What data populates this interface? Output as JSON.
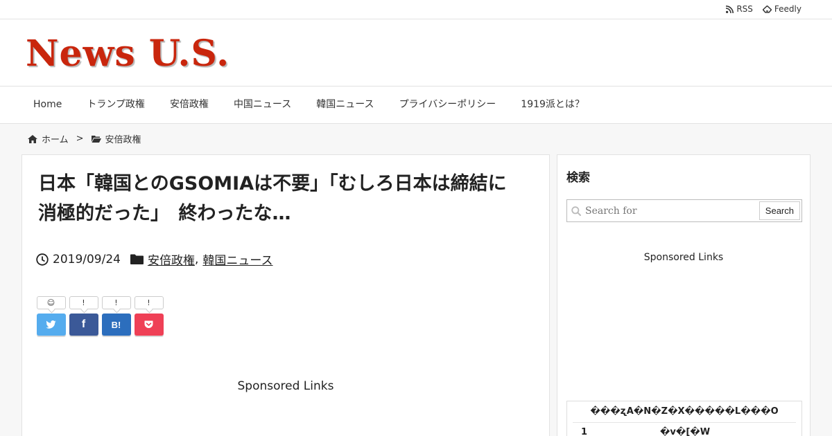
{
  "topbar": {
    "rss_label": "RSS",
    "feedly_label": "Feedly"
  },
  "header": {
    "logo_text": "News U.S."
  },
  "nav": {
    "items": [
      "Home",
      "トランプ政権",
      "安倍政権",
      "中国ニュース",
      "韓国ニュース",
      "プライバシーポリシー",
      "1919派とは？"
    ]
  },
  "breadcrumb": {
    "home": "ホーム",
    "separator": ">",
    "category": "安倍政権"
  },
  "article": {
    "title_line1": "日本「韓国とのGSOMIAは不要」「むしろ日本は締結に",
    "title_line2": "消極的だった」　終わったな…",
    "date": "2019/09/24",
    "categories": [
      "安倍政権",
      "韓国ニュース"
    ],
    "category_separator": ",",
    "sponsored": "Sponsored Links"
  },
  "share": {
    "buttons": [
      {
        "name": "twitter",
        "count": "☺",
        "label": "",
        "color": "#55acee",
        "icon": "twitter-icon"
      },
      {
        "name": "facebook",
        "count": "!",
        "label": "f",
        "color": "#3b5998",
        "icon": "facebook-icon"
      },
      {
        "name": "hatena",
        "count": "!",
        "label": "B!",
        "color": "#2c6ebd",
        "icon": "hatena-icon"
      },
      {
        "name": "pocket",
        "count": "!",
        "label": "",
        "color": "#ef4056",
        "icon": "pocket-icon"
      }
    ]
  },
  "sidebar": {
    "search_title": "検索",
    "search_placeholder": "Search for",
    "search_button": "Search",
    "sponsored": "Sponsored Links",
    "ranking_header": "���ʐA�N�Z�X�����L���O",
    "ranking_item_num": "1",
    "ranking_item_text": "�v�[�W"
  }
}
